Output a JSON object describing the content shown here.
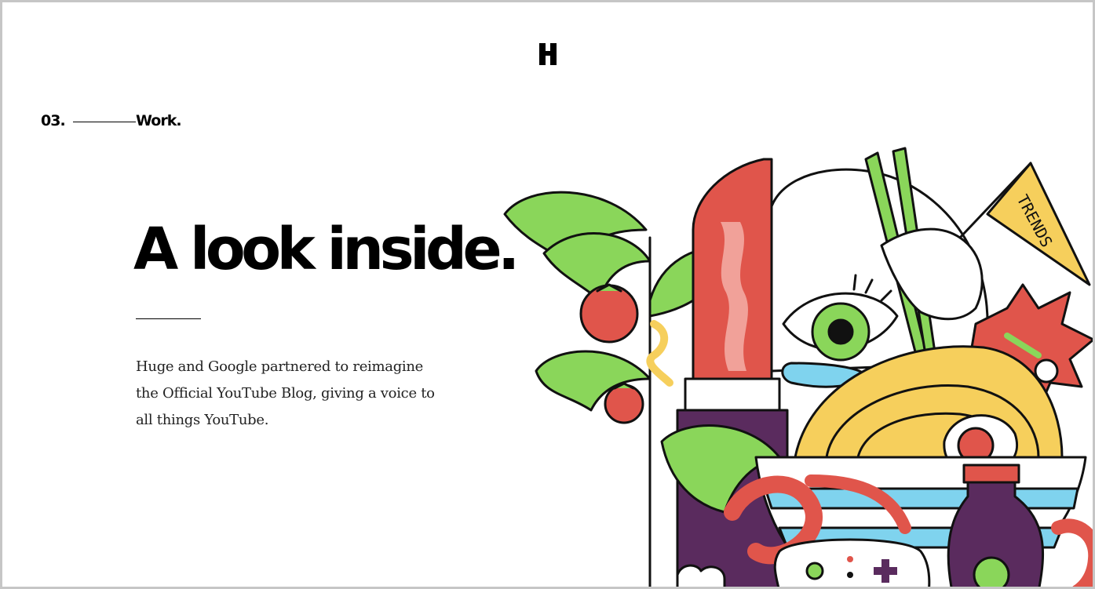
{
  "header": {
    "logo_icon": "huge-h-logo"
  },
  "section": {
    "number": "03.",
    "name": "Work."
  },
  "hero": {
    "headline": "A look inside.",
    "description": "Huge and Google partnered to reimagine the Official YouTube Blog, giving a voice to all things YouTube."
  },
  "illustration": {
    "pennant_text": "TRENDS",
    "colors": {
      "red": "#e0554b",
      "green": "#8ad65a",
      "yellow": "#f6cf5c",
      "blue": "#7fd3ee",
      "purple": "#5a2b5e",
      "outline": "#111111"
    }
  }
}
